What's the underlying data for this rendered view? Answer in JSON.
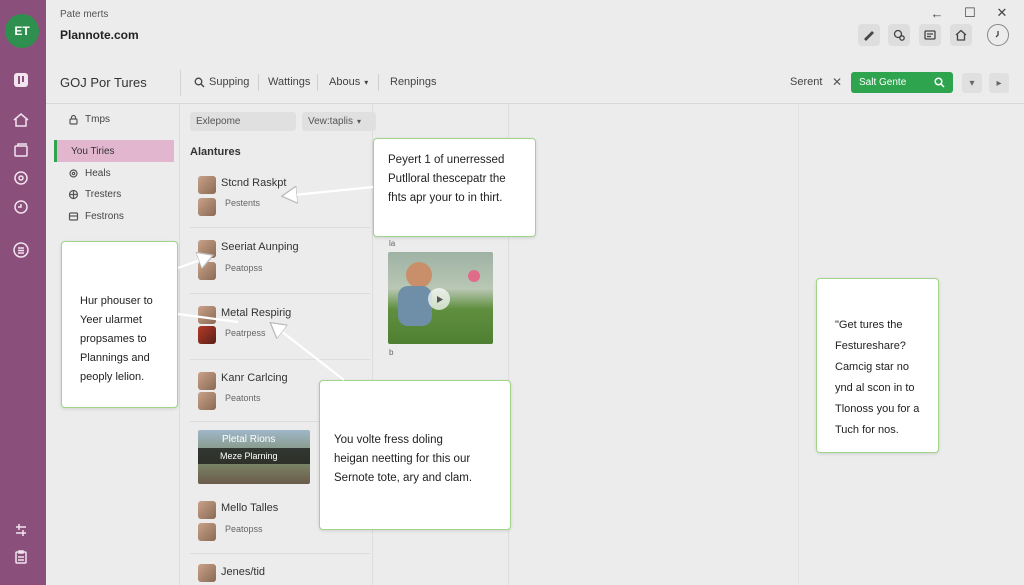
{
  "rail": {
    "avatar": "ET",
    "icons": [
      "app-logo-icon",
      "home-icon",
      "folder-icon",
      "settings-icon",
      "activity-icon",
      "list-icon",
      "filter-icon",
      "clipboard-icon"
    ]
  },
  "header": {
    "subtitle": "Pate merts",
    "title": "Plannote.com",
    "window": {
      "back": "←",
      "maximize": "☐",
      "close": "✕"
    },
    "tools": [
      "pencil-icon",
      "share-icon",
      "document-icon",
      "home-icon",
      "clock-icon"
    ]
  },
  "toolbar": {
    "section_title": "GOJ Por Tures",
    "items": [
      "Supping",
      "Wattings",
      "Abous",
      "Renpings"
    ],
    "search_label": "Serent",
    "search_clear": "✕",
    "search_button": "Salt Gente"
  },
  "nav": {
    "top_item": "Tmps",
    "active_item": "You Tiries",
    "items": [
      "Heals",
      "Tresters",
      "Festrons"
    ]
  },
  "list": {
    "filter_placeholder": "Exlepome",
    "filter_view": "Vew:taplis",
    "heading": "Alantures",
    "rows": [
      {
        "title": "Stcnd Raskpt",
        "sub": "Pestents"
      },
      {
        "title": "Seeriat Aunping",
        "sub": "Peatopss"
      },
      {
        "title": "Metal Respirig",
        "sub": "Peatrpess"
      },
      {
        "title": "Kanr Carlcing",
        "sub": "Peatonts"
      },
      {
        "title": "Pletal Rions",
        "sub": "Meze Plarning"
      },
      {
        "title": "Mello Talles",
        "sub": "Peatopss"
      },
      {
        "title": "Jenes/tid",
        "sub": ""
      }
    ]
  },
  "preview": {
    "label_top": "la",
    "label_bottom": "b"
  },
  "callouts": {
    "top": [
      "Peyert 1 of unerressed",
      "Putlloral thescepatr the",
      "fhts apr your to in thirt."
    ],
    "left": [
      "Hur phouser to",
      "Yeer ularmet",
      "propsames to",
      "Plannings and",
      "peoply lelion."
    ],
    "middle": [
      "You volte fress doling",
      "heigan neetting for this our",
      "Sernote tote, ary and clam."
    ],
    "right": [
      "\"Get tures the",
      "Festureshare?",
      "Camcig star no",
      "ynd al scon in to",
      "Tlonoss you for a",
      "Tuch for nos."
    ]
  }
}
